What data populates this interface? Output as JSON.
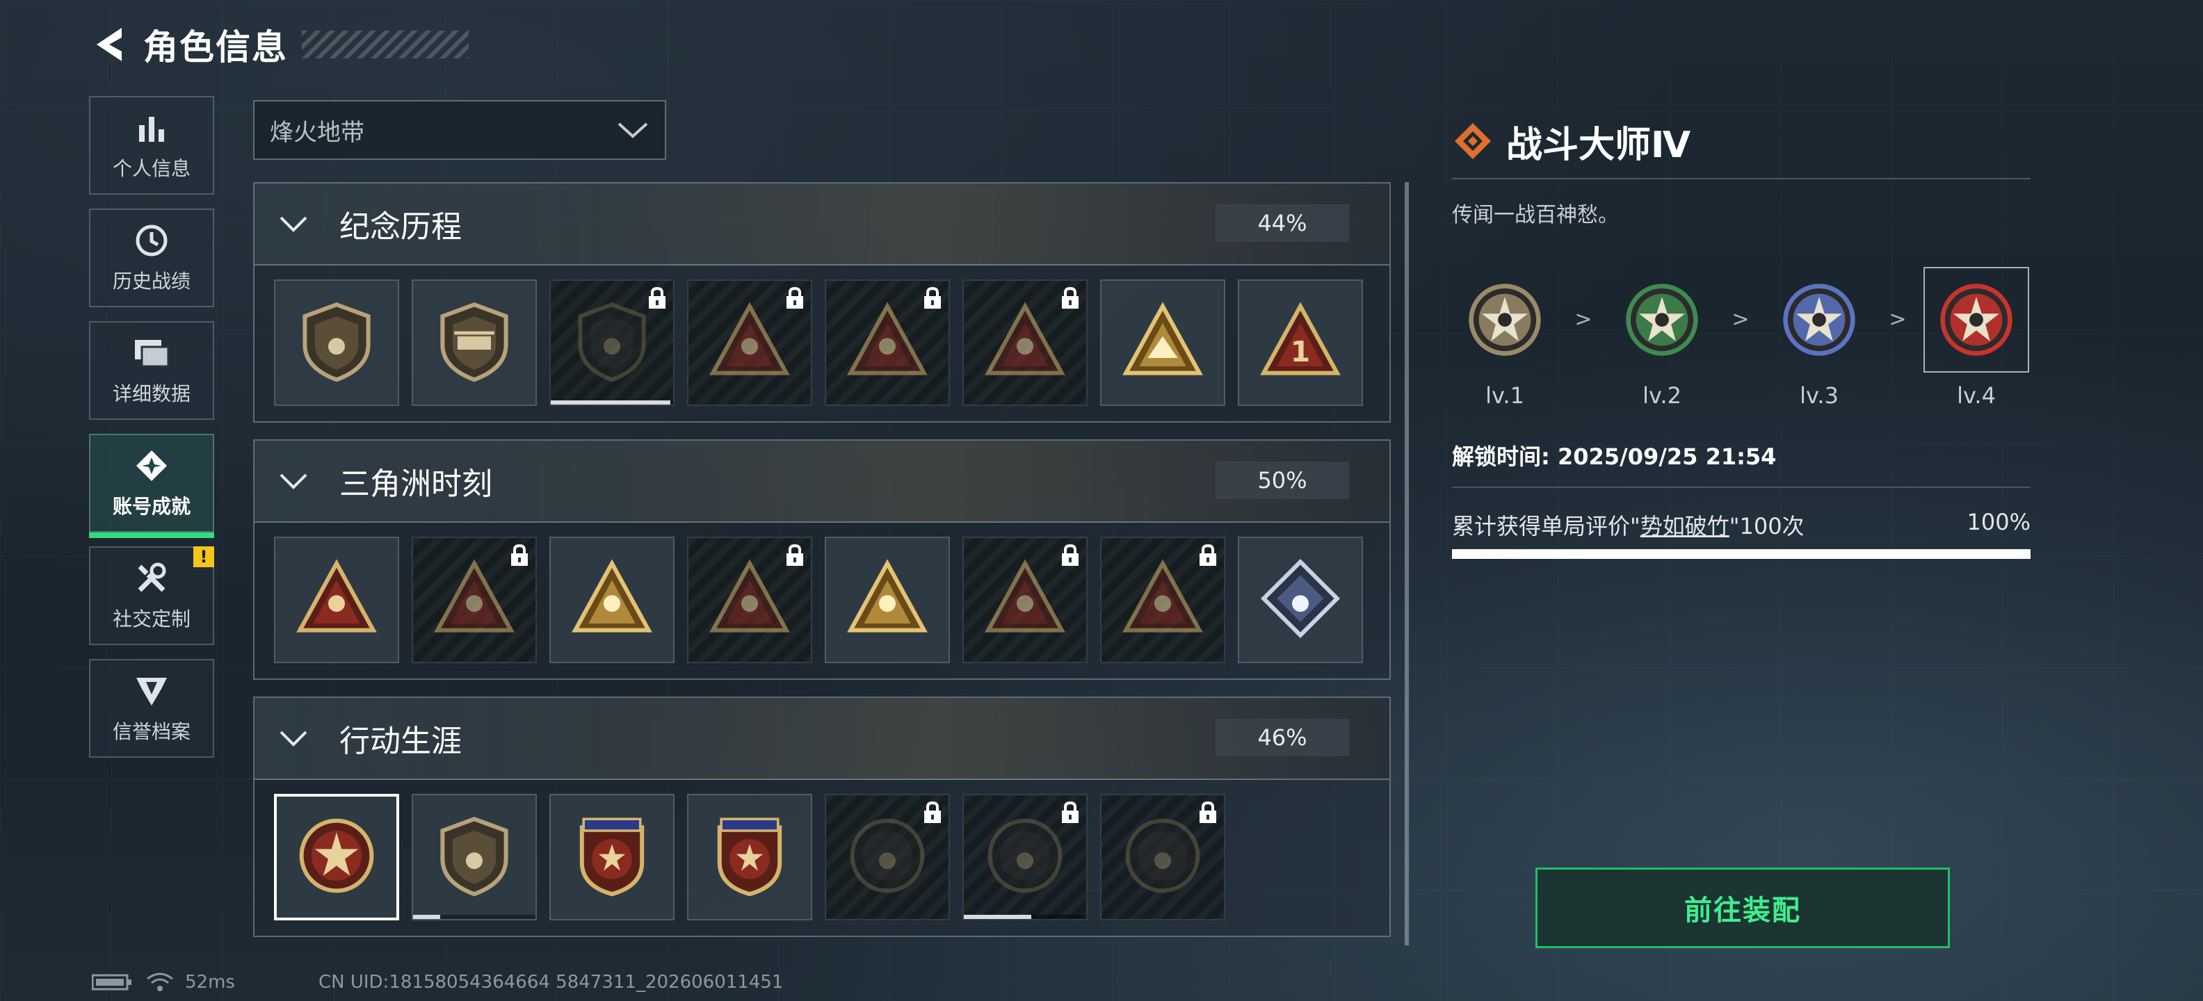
{
  "header": {
    "title": "角色信息"
  },
  "sidebar": {
    "items": [
      {
        "label": "个人信息",
        "icon": "bar-chart-icon",
        "active": false
      },
      {
        "label": "历史战绩",
        "icon": "clock-icon",
        "active": false
      },
      {
        "label": "详细数据",
        "icon": "folders-icon",
        "active": false
      },
      {
        "label": "账号成就",
        "icon": "achievement-icon",
        "active": true
      },
      {
        "label": "社交定制",
        "icon": "tools-icon",
        "active": false,
        "badge": "!"
      },
      {
        "label": "信誉档案",
        "icon": "credit-icon",
        "active": false
      }
    ]
  },
  "filter": {
    "selected": "烽火地带"
  },
  "sections": [
    {
      "name": "纪念历程",
      "percent": "44%",
      "tiles": [
        {
          "icon": "triangle-shield-badge",
          "locked": false,
          "palette": "bronze"
        },
        {
          "icon": "helicopter-badge",
          "locked": false,
          "palette": "bronze"
        },
        {
          "icon": "hex-emblem-badge",
          "locked": true,
          "palette": "dark",
          "progress": 0.98
        },
        {
          "icon": "soldier-cross-badge",
          "locked": true,
          "palette": "red"
        },
        {
          "icon": "hooded-figure-badge",
          "locked": true,
          "palette": "red"
        },
        {
          "icon": "crossed-rifles-badge",
          "locked": true,
          "palette": "red"
        },
        {
          "icon": "tent-badge",
          "locked": false,
          "palette": "gold"
        },
        {
          "icon": "number-one-badge",
          "locked": false,
          "palette": "red"
        }
      ]
    },
    {
      "name": "三角洲时刻",
      "percent": "50%",
      "tiles": [
        {
          "icon": "usb-drive-badge",
          "locked": false,
          "palette": "red"
        },
        {
          "icon": "tower-badge",
          "locked": true,
          "palette": "red"
        },
        {
          "icon": "sitting-figure-badge",
          "locked": false,
          "palette": "gold"
        },
        {
          "icon": "beast-badge",
          "locked": true,
          "palette": "red"
        },
        {
          "icon": "squad-badge",
          "locked": false,
          "palette": "gold"
        },
        {
          "icon": "dog-badge",
          "locked": true,
          "palette": "red"
        },
        {
          "icon": "fish-badge",
          "locked": true,
          "palette": "red"
        },
        {
          "icon": "diamond-rose-badge",
          "locked": false,
          "palette": "silver"
        }
      ]
    },
    {
      "name": "行动生涯",
      "percent": "46%",
      "tiles": [
        {
          "icon": "combat-master-badge",
          "locked": false,
          "palette": "red",
          "selected": true
        },
        {
          "icon": "rank-shield-badge",
          "locked": false,
          "palette": "bronze",
          "progress": 0.22
        },
        {
          "icon": "star-shield-badge",
          "locked": false,
          "palette": "red"
        },
        {
          "icon": "star-diamond-badge",
          "locked": false,
          "palette": "red"
        },
        {
          "icon": "orbit-medal-badge",
          "locked": true,
          "palette": "dark"
        },
        {
          "icon": "skull-medal-badge",
          "locked": true,
          "palette": "dark",
          "progress": 0.55
        },
        {
          "icon": "eye-medal-badge",
          "locked": true,
          "palette": "dark"
        }
      ]
    }
  ],
  "detail": {
    "title": "战斗大师Ⅳ",
    "description": "传闻一战百神愁。",
    "levels": [
      {
        "label": "lv.1",
        "color": "#9a8a6a"
      },
      {
        "label": "lv.2",
        "color": "#3f8a4f"
      },
      {
        "label": "lv.3",
        "color": "#5a74c2"
      },
      {
        "label": "lv.4",
        "color": "#c8332c"
      }
    ],
    "arrow": ">",
    "unlock_time": "解锁时间: 2025/09/25 21:54",
    "condition_pre": "累计获得单局评价\"",
    "condition_highlight": "势如破竹",
    "condition_post": "\"100次",
    "condition_percent": "100%",
    "condition_progress": 1.0
  },
  "action_button": {
    "label": "前往装配"
  },
  "status": {
    "ping": "52ms",
    "uid": "CN UID:18158054364664 5847311_202606011451"
  },
  "colors": {
    "accent": "#2ee07b",
    "warning": "#f5c518",
    "orange": "#e0702a"
  }
}
